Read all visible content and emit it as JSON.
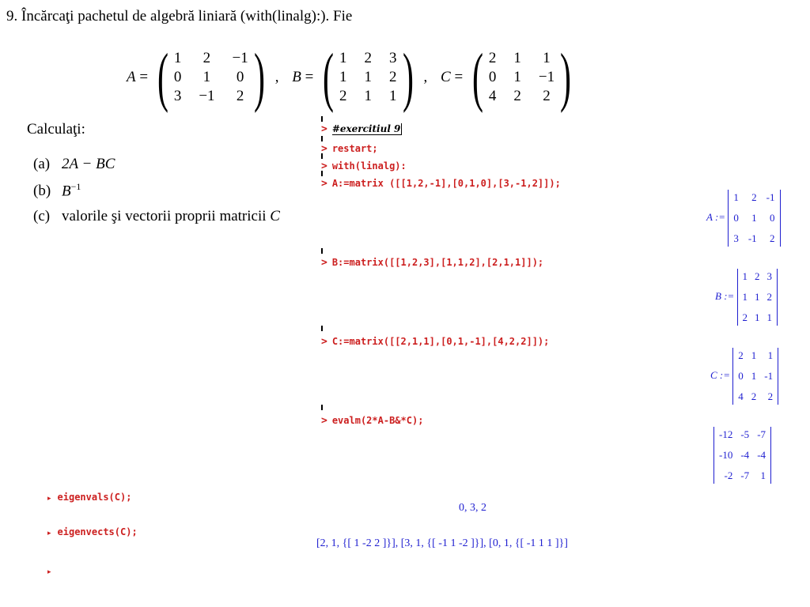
{
  "problem": {
    "number": "9.",
    "intro": "Încărcaţi pachetul de algebră liniară (with(linalg):). Fie",
    "matrices": [
      {
        "name": "A",
        "rows": [
          [
            "1",
            "2",
            "−1"
          ],
          [
            "0",
            "1",
            "0"
          ],
          [
            "3",
            "−1",
            "2"
          ]
        ]
      },
      {
        "name": "B",
        "rows": [
          [
            "1",
            "2",
            "3"
          ],
          [
            "1",
            "1",
            "2"
          ],
          [
            "2",
            "1",
            "1"
          ]
        ]
      },
      {
        "name": "C",
        "rows": [
          [
            "2",
            "1",
            "1"
          ],
          [
            "0",
            "1",
            "−1"
          ],
          [
            "4",
            "2",
            "2"
          ]
        ]
      }
    ],
    "calc_label": "Calculaţi:",
    "items": [
      {
        "key": "(a)",
        "text": "2A − BC"
      },
      {
        "key": "(b)",
        "text": "B",
        "sup": "−1"
      },
      {
        "key": "(c)",
        "text": "valorile şi vectorii proprii matricii ",
        "tail": "C"
      }
    ]
  },
  "worksheet": {
    "comment": "#exercitiul 9",
    "cmd_restart": "restart;",
    "cmd_with": "with(linalg):",
    "cmd_A": "A:=matrix ([[1,2,-1],[0,1,0],[3,-1,2]]);",
    "cmd_B": "B:=matrix([[1,2,3],[1,1,2],[2,1,1]]);",
    "cmd_C": "C:=matrix([[2,1,1],[0,1,-1],[4,2,2]]);",
    "cmd_evalm": "evalm(2*A-B&*C);",
    "cmd_eigenvals": "eigenvals(C);",
    "cmd_eigenvects": "eigenvects(C);",
    "prompt_symbol": ">",
    "out_A_label": "A :=",
    "out_A": [
      [
        "1",
        "2",
        "-1"
      ],
      [
        "0",
        "1",
        "0"
      ],
      [
        "3",
        "-1",
        "2"
      ]
    ],
    "out_B_label": "B :=",
    "out_B": [
      [
        "1",
        "2",
        "3"
      ],
      [
        "1",
        "1",
        "2"
      ],
      [
        "2",
        "1",
        "1"
      ]
    ],
    "out_C_label": "C :=",
    "out_C": [
      [
        "2",
        "1",
        "1"
      ],
      [
        "0",
        "1",
        "-1"
      ],
      [
        "4",
        "2",
        "2"
      ]
    ],
    "out_evalm": [
      [
        "-12",
        "-5",
        "-7"
      ],
      [
        "-10",
        "-4",
        "-4"
      ],
      [
        "-2",
        "-7",
        "1"
      ]
    ],
    "out_eigenvals": "0, 3, 2",
    "out_eigenvects": "[2, 1, {[ 1  -2  2 ]}], [3, 1, {[ -1  1  -2 ]}], [0, 1, {[ -1  1  1 ]}]"
  },
  "colors": {
    "command": "#cc1f1f",
    "output": "#1e1ed0"
  }
}
